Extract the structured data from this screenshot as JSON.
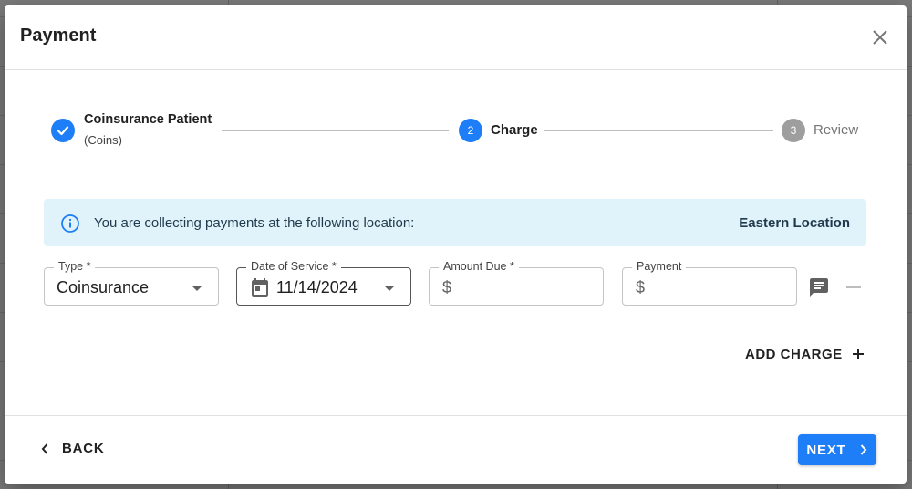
{
  "dialog": {
    "title": "Payment"
  },
  "stepper": {
    "steps": [
      {
        "label": "Coinsurance Patient",
        "sublabel": "(Coins)",
        "state": "completed"
      },
      {
        "label": "Charge",
        "number": "2",
        "state": "active"
      },
      {
        "label": "Review",
        "number": "3",
        "state": "inactive"
      }
    ]
  },
  "banner": {
    "icon": "info-icon",
    "text": "You are collecting payments at the following location:",
    "location": "Eastern Location"
  },
  "form": {
    "type": {
      "label": "Type *",
      "value": "Coinsurance"
    },
    "date_of_service": {
      "label": "Date of Service *",
      "value": "11/14/2024",
      "icon": "calendar-icon"
    },
    "amount_due": {
      "label": "Amount Due *",
      "prefix": "$",
      "value": ""
    },
    "payment": {
      "label": "Payment",
      "prefix": "$",
      "value": ""
    }
  },
  "actions": {
    "add_charge": "ADD CHARGE",
    "back": "BACK",
    "next": "NEXT"
  },
  "colors": {
    "primary": "#1e7ef7",
    "inactive_step": "#9e9e9e",
    "banner_bg": "#e1f3fa"
  }
}
